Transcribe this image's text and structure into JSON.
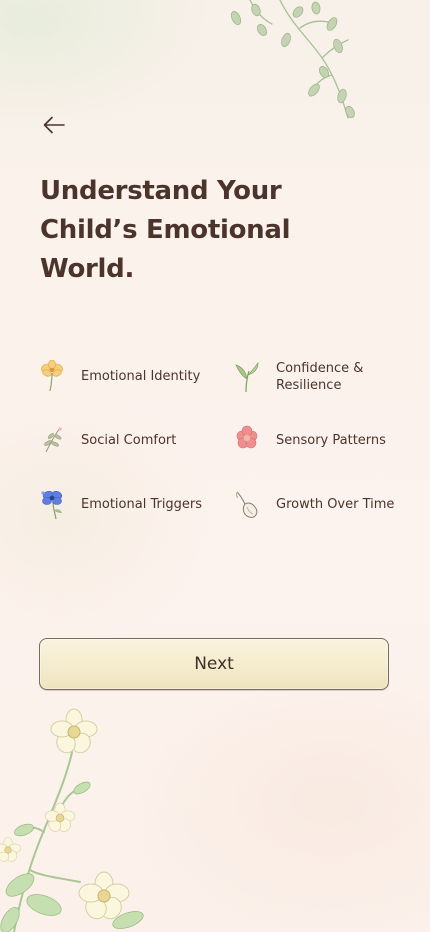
{
  "header": {
    "back_icon": "arrow-left-icon"
  },
  "main": {
    "title": "Understand Your Child’s Emotional World."
  },
  "features": [
    {
      "label": "Emotional Identity",
      "icon": "yellow-flower-icon"
    },
    {
      "label": "Confidence & Resilience",
      "icon": "green-sprout-icon"
    },
    {
      "label": "Social Comfort",
      "icon": "sprig-icon"
    },
    {
      "label": "Sensory Patterns",
      "icon": "pink-flower-icon"
    },
    {
      "label": "Emotional Triggers",
      "icon": "blue-flower-icon"
    },
    {
      "label": "Growth Over Time",
      "icon": "seed-pod-icon"
    }
  ],
  "actions": {
    "next_label": "Next"
  },
  "colors": {
    "text": "#4a342c",
    "background": "#fcf2ec",
    "button_fill": "#f4ecce",
    "button_border": "#7b6a5e"
  }
}
